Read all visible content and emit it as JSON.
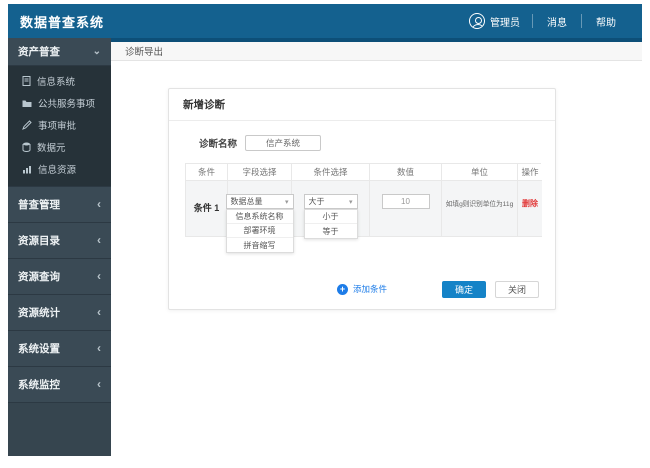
{
  "app_title": "数据普查系统",
  "header": {
    "user_label": "管理员",
    "messages_label": "消息",
    "help_label": "帮助"
  },
  "sidebar": {
    "census": {
      "label": "资产普查",
      "items": [
        {
          "label": "信息系统",
          "icon": "document-icon"
        },
        {
          "label": "公共服务事项",
          "icon": "folder-icon"
        },
        {
          "label": "事项审批",
          "icon": "edit-icon"
        },
        {
          "label": "数据元",
          "icon": "database-icon"
        },
        {
          "label": "信息资源",
          "icon": "chart-icon"
        }
      ]
    },
    "sections": [
      {
        "label": "普查管理"
      },
      {
        "label": "资源目录"
      },
      {
        "label": "资源查询"
      },
      {
        "label": "资源统计"
      },
      {
        "label": "系统设置"
      },
      {
        "label": "系统监控"
      }
    ]
  },
  "tabs": {
    "active": "诊断导出"
  },
  "modal": {
    "title": "新增诊断",
    "name_label": "诊断名称",
    "name_value": "信产系统",
    "table": {
      "headers": [
        "条件",
        "字段选择",
        "条件选择",
        "数值",
        "单位",
        "操作"
      ],
      "row": {
        "condition_label": "条件 1",
        "field_select": {
          "value": "数据总量",
          "options": [
            "信息系统名称",
            "部署环境",
            "拼音缩写"
          ]
        },
        "condition_select": {
          "value": "大于",
          "options": [
            "小于",
            "等于"
          ]
        },
        "value": "10",
        "unit_hint": "如填g则识别单位为11g",
        "delete_label": "删除"
      }
    },
    "add_condition_label": "添加条件",
    "confirm_label": "确定",
    "close_label": "关闭"
  },
  "colors": {
    "header_blue": "#14618f",
    "strip_blue": "#0d4f78",
    "sidebar_dark": "#263239",
    "sidebar_section": "#3a4a55",
    "primary_blue": "#1583c7",
    "link_blue": "#1d7ce8",
    "delete_red": "#e23c3c"
  }
}
